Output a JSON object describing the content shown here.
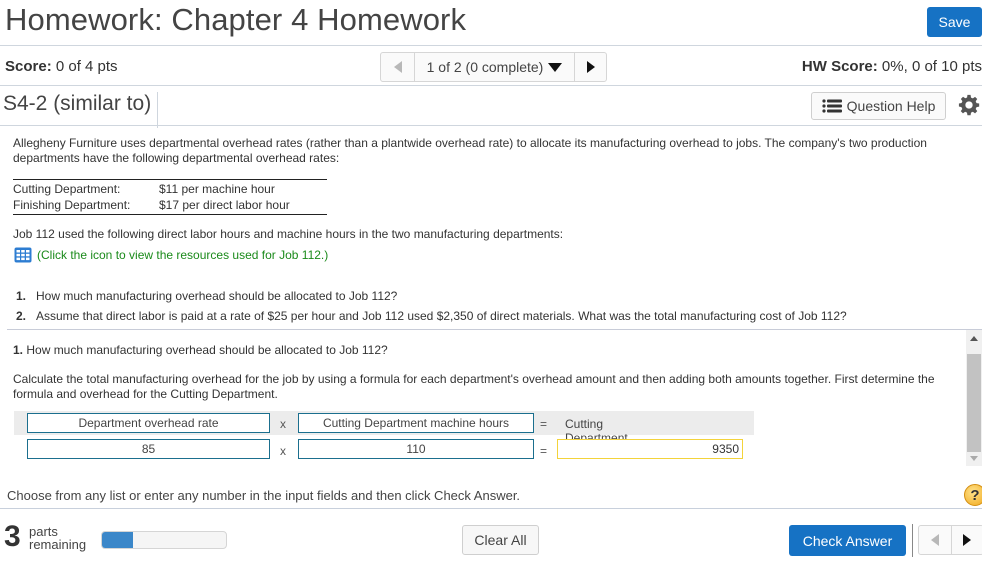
{
  "header": {
    "title": "Homework: Chapter 4 Homework",
    "save_label": "Save"
  },
  "score_bar": {
    "score_label": "Score:",
    "score_value": " 0 of 4 pts",
    "pager_label": "1 of 2 (0 complete)",
    "hw_score_label": "HW Score:",
    "hw_score_value": " 0%, 0 of 10 pts"
  },
  "question_bar": {
    "question_id": "S4-2 (similar to)",
    "help_label": "Question Help"
  },
  "problem": {
    "intro": "Allegheny Furniture uses departmental overhead rates (rather than a plantwide overhead rate) to allocate its manufacturing overhead to jobs. The company's two production departments have the following departmental overhead rates:",
    "rates": [
      {
        "department": "Cutting Department:",
        "rate": "$11 per machine hour"
      },
      {
        "department": "Finishing Department:",
        "rate": "$17 per direct labor hour"
      }
    ],
    "job_text": "Job 112 used the following direct labor hours and machine hours in the two manufacturing departments:",
    "resource_link": "(Click the icon to view the resources used for Job 112.)",
    "questions": [
      {
        "num": "1.",
        "text": "How much manufacturing overhead should be allocated to Job 112?"
      },
      {
        "num": "2.",
        "text": "Assume that direct labor is paid at a rate of $25 per hour and Job 112 used $2,350 of direct materials. What was the total manufacturing cost of Job 112?"
      }
    ]
  },
  "answer": {
    "part_num": "1.",
    "part_question": " How much manufacturing overhead should be allocated to Job 112?",
    "instructions": "Calculate the total manufacturing overhead for the job by using a formula for each department's overhead amount and then adding both amounts together. First determine the formula and overhead for the Cutting Department.",
    "formula": {
      "header_left": "Department overhead rate",
      "header_mid": "Cutting Department machine hours",
      "header_result": "Cutting Department overhead",
      "op_multiply": "x",
      "op_equals": "=",
      "value_left": "85",
      "value_mid": "110",
      "value_result": "9350"
    }
  },
  "footer": {
    "hint": "Choose from any list or enter any number in the input fields and then click Check Answer.",
    "help_symbol": "?",
    "parts_remaining": "3",
    "parts_label_1": "parts",
    "parts_label_2": "remaining",
    "progress_fraction": 0.25,
    "clear_label": "Clear All",
    "check_label": "Check Answer"
  },
  "colors": {
    "primary_button": "#1672c4",
    "link_green": "#1a8a1a",
    "input_border": "#1b6f8e",
    "result_border": "#f3d33b",
    "progress_fill": "#3b87c9"
  }
}
